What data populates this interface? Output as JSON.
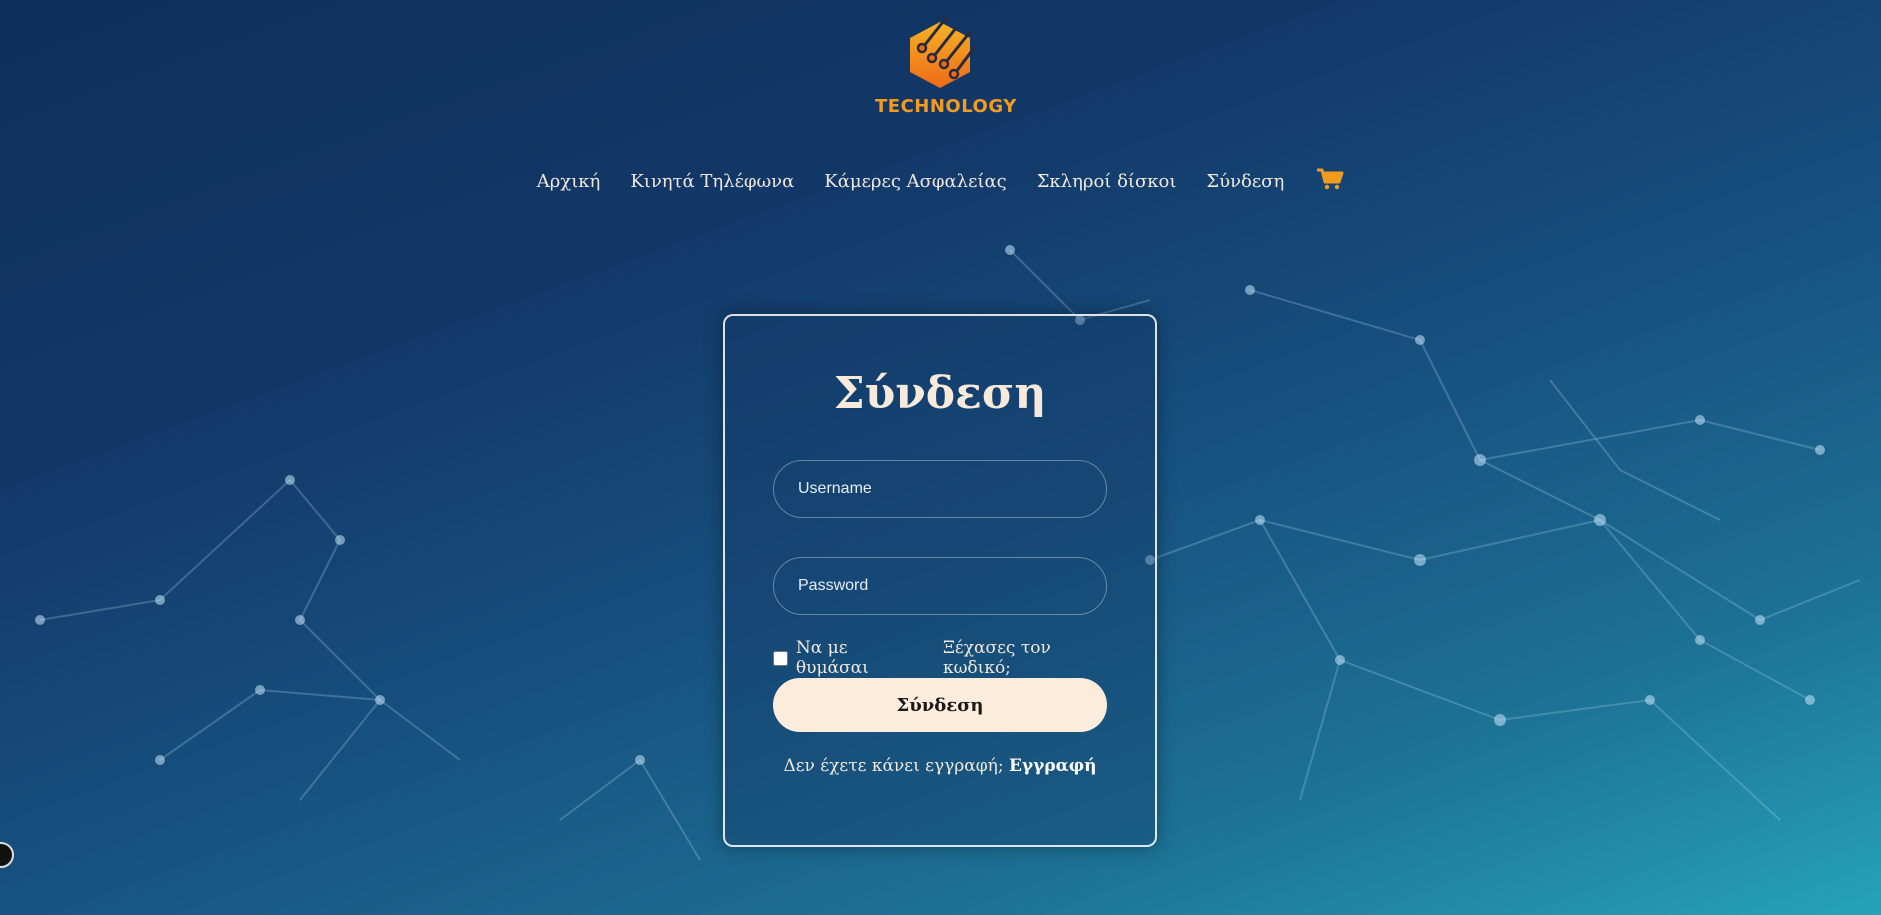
{
  "brand": {
    "logo_text": "TECHNOLOGY",
    "accent_color": "#f29c1f"
  },
  "nav": {
    "items": [
      {
        "label": "Αρχική"
      },
      {
        "label": "Κινητά Τηλέφωνα"
      },
      {
        "label": "Κάμερες Ασφαλείας"
      },
      {
        "label": "Σκληροί δίσκοι"
      },
      {
        "label": "Σύνδεση"
      }
    ],
    "cart_icon": "shopping-cart-icon"
  },
  "login": {
    "title": "Σύνδεση",
    "username_placeholder": "Username",
    "password_placeholder": "Password",
    "remember_label": "Να με θυμάσαι",
    "forgot_label": "Ξέχασες τον κωδικό;",
    "submit_label": "Σύνδεση",
    "register_prompt": "Δεν έχετε κάνει εγγραφή;",
    "register_link": "Εγγραφή"
  },
  "colors": {
    "button_bg": "#fbecdc",
    "text": "#f1e8dc"
  }
}
